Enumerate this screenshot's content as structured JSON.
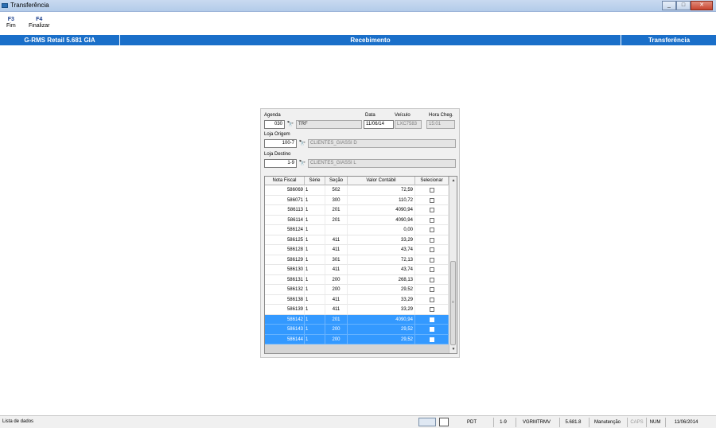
{
  "window": {
    "title": "Transferência"
  },
  "fkeys": [
    {
      "key": "F3",
      "label": "Fim"
    },
    {
      "key": "F4",
      "label": "Finalizar"
    }
  ],
  "header": {
    "app": "G-RMS Retail 5.681 GIA",
    "module": "Recebimento",
    "screen": "Transferência"
  },
  "form": {
    "agenda_label": "Agenda",
    "agenda_value": "030",
    "agenda_desc": "TRF",
    "data_label": "Data",
    "data_value": "11/06/14",
    "veiculo_label": "Veículo",
    "veiculo_value": "LXC7583",
    "hora_label": "Hora Cheg.",
    "hora_value": "15:01",
    "origem_label": "Loja Origem",
    "origem_value": "100-7",
    "origem_desc": "CLIENTES_GIASSI D",
    "destino_label": "Loja Destino",
    "destino_value": "1-9",
    "destino_desc": "CLIENTES_GIASSI L"
  },
  "grid": {
    "columns": [
      "Nota Fiscal",
      "Série",
      "Seção",
      "Valor Contábil",
      "Selecionar"
    ],
    "rows": [
      {
        "nf": "586069",
        "serie": "1",
        "secao": "502",
        "valor": "72,59",
        "selected": false
      },
      {
        "nf": "586071",
        "serie": "1",
        "secao": "300",
        "valor": "110,72",
        "selected": false
      },
      {
        "nf": "586113",
        "serie": "1",
        "secao": "201",
        "valor": "4090,94",
        "selected": false
      },
      {
        "nf": "586114",
        "serie": "1",
        "secao": "201",
        "valor": "4090,94",
        "selected": false
      },
      {
        "nf": "586124",
        "serie": "1",
        "secao": "",
        "valor": "0,00",
        "selected": false
      },
      {
        "nf": "586125",
        "serie": "1",
        "secao": "411",
        "valor": "33,29",
        "selected": false
      },
      {
        "nf": "586128",
        "serie": "1",
        "secao": "411",
        "valor": "43,74",
        "selected": false
      },
      {
        "nf": "586129",
        "serie": "1",
        "secao": "301",
        "valor": "72,13",
        "selected": false
      },
      {
        "nf": "586130",
        "serie": "1",
        "secao": "411",
        "valor": "43,74",
        "selected": false
      },
      {
        "nf": "586131",
        "serie": "1",
        "secao": "200",
        "valor": "268,13",
        "selected": false
      },
      {
        "nf": "586132",
        "serie": "1",
        "secao": "200",
        "valor": "29,52",
        "selected": false
      },
      {
        "nf": "586138",
        "serie": "1",
        "secao": "411",
        "valor": "33,29",
        "selected": false
      },
      {
        "nf": "586139",
        "serie": "1",
        "secao": "411",
        "valor": "33,29",
        "selected": false
      },
      {
        "nf": "586142",
        "serie": "1",
        "secao": "201",
        "valor": "4090,94",
        "selected": true
      },
      {
        "nf": "586143",
        "serie": "1",
        "secao": "200",
        "valor": "29,52",
        "selected": true
      },
      {
        "nf": "586144",
        "serie": "1",
        "secao": "200",
        "valor": "29,52",
        "selected": true
      }
    ]
  },
  "status": {
    "left": "Lista de dados",
    "pdt": "PDT",
    "loja": "1-9",
    "program": "VGRMTRMV",
    "version": "5.681.8",
    "mode": "Manutenção",
    "caps": "CAPS",
    "num": "NUM",
    "date": "11/06/2014"
  }
}
